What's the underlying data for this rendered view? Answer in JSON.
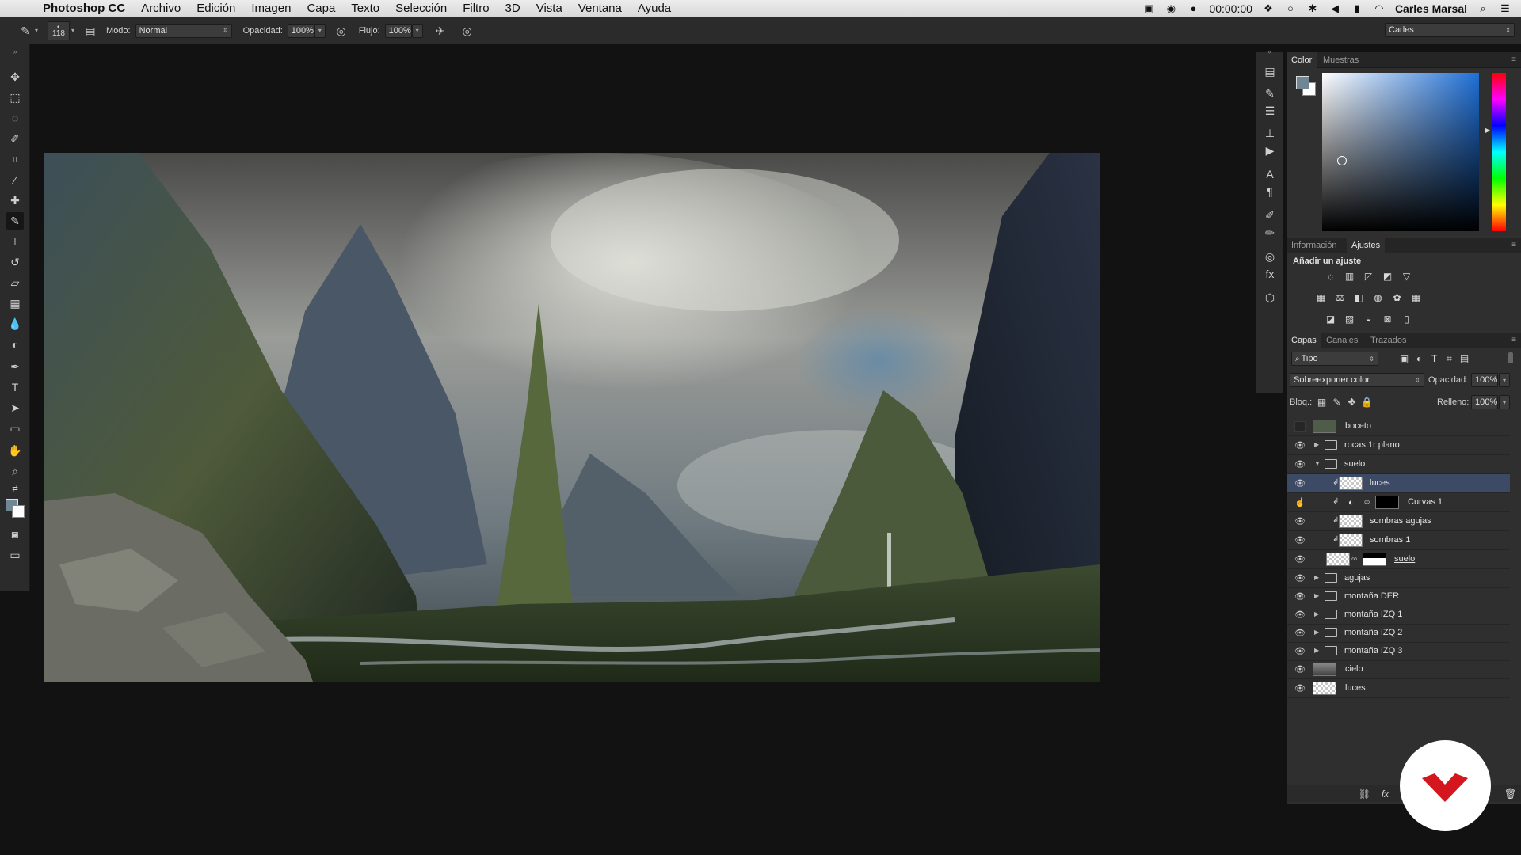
{
  "menubar": {
    "app_name": "Photoshop CC",
    "items": [
      "Archivo",
      "Edición",
      "Imagen",
      "Capa",
      "Texto",
      "Selección",
      "Filtro",
      "3D",
      "Vista",
      "Ventana",
      "Ayuda"
    ],
    "clock": "00:00:00",
    "user": "Carles Marsal"
  },
  "options_bar": {
    "brush_size": "118",
    "mode_label": "Modo:",
    "mode_value": "Normal",
    "opacity_label": "Opacidad:",
    "opacity_value": "100%",
    "flow_label": "Flujo:",
    "flow_value": "100%",
    "workspace": "Carles"
  },
  "color_panel": {
    "tabs": [
      "Color",
      "Muestras"
    ]
  },
  "adjustments_panel": {
    "tabs": [
      "Información",
      "Ajustes"
    ],
    "heading": "Añadir un ajuste"
  },
  "layers_panel": {
    "tabs": [
      "Capas",
      "Canales",
      "Trazados"
    ],
    "filter_value": "Tipo",
    "blend_mode": "Sobreexponer color",
    "opacity_label": "Opacidad:",
    "opacity_value": "100%",
    "lock_label": "Bloq.:",
    "fill_label": "Relleno:",
    "fill_value": "100%",
    "layers": [
      {
        "name": "boceto",
        "kind": "image",
        "visible": false
      },
      {
        "name": "rocas 1r plano",
        "kind": "group",
        "visible": true
      },
      {
        "name": "suelo",
        "kind": "group-open",
        "visible": true
      },
      {
        "name": "luces",
        "kind": "clip",
        "visible": true,
        "selected": true
      },
      {
        "name": "Curvas 1",
        "kind": "adjustment",
        "visible": false
      },
      {
        "name": "sombras agujas",
        "kind": "clip",
        "visible": true
      },
      {
        "name": "sombras 1",
        "kind": "clip",
        "visible": true
      },
      {
        "name": "suelo",
        "kind": "masked",
        "visible": true
      },
      {
        "name": "agujas",
        "kind": "group",
        "visible": true
      },
      {
        "name": "montaña DER",
        "kind": "group",
        "visible": true
      },
      {
        "name": "montaña IZQ 1",
        "kind": "group",
        "visible": true
      },
      {
        "name": "montaña IZQ 2",
        "kind": "group",
        "visible": true
      },
      {
        "name": "montaña IZQ 3",
        "kind": "group",
        "visible": true
      },
      {
        "name": "cielo",
        "kind": "image",
        "visible": true
      },
      {
        "name": "luces",
        "kind": "image",
        "visible": true
      }
    ]
  },
  "icons": {
    "foreground_color": "#6f8794",
    "background_color": "#ffffff",
    "selected_layer_color": "#3d4a66",
    "brand_color": "#d4171e"
  }
}
